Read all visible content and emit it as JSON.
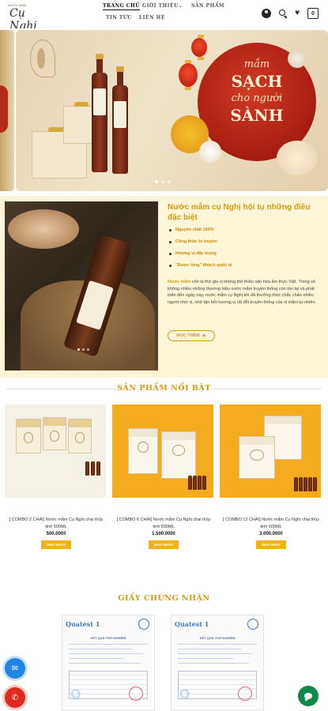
{
  "brand": {
    "tagline": "NƯỚC MẮM",
    "name": "Cụ Nghị"
  },
  "nav": {
    "items": [
      {
        "label": "TRANG CHỦ"
      },
      {
        "label": "GIỚI THIỆU"
      },
      {
        "label": "SẢN PHẨM"
      },
      {
        "label": "TIN TỨC"
      },
      {
        "label": "LIÊN HỆ"
      }
    ],
    "dropdown_caret": "⌄"
  },
  "header": {
    "cart_count": "0",
    "icons": [
      "user-icon",
      "search-icon",
      "heart-icon",
      "cart-icon"
    ]
  },
  "banner": {
    "line1": "mắm",
    "line2": "SẠCH",
    "line3": "cho người",
    "line4": "SÀNH",
    "slide_count": 3,
    "active_slide": 1
  },
  "intro": {
    "title": "Nước mắm cụ Nghị hội tụ những điều đặc biệt",
    "features": [
      "Nguyên chất 100%",
      "Công thức bí truyền",
      "Hương vị đặc trưng",
      "\"Được lòng\" khách quốc tế"
    ],
    "para_highlight": "Nước mắm",
    "para_rest": " vốn là thứ gia vị không thể thiếu văn hóa ẩm thực Việt. Trong số không nhiều những thương hiệu nước mắm truyền thống còn tồn tại và phát triển đến ngày nay, nước mắm cụ Nghị khi đã thưởng thức chắc chắn nhiều người nhớ vị, nhớ tận bởi hương vị rất đỗi truyền thống của vị mắm tự nhiên.",
    "read_more": "ĐỌC THÊM",
    "read_more_arrow": "▶"
  },
  "products_section": {
    "title": "SẢN PHẨM NỔI BẬT",
    "items": [
      {
        "name": "[ COMBO 2 CHAI] Nước mắm Cụ Nghị chai thủy tinh 500ML",
        "price": "500.000₫",
        "button": "MUA NGAY"
      },
      {
        "name": "[ COMBO 6 CHAI] Nước mắm Cụ Nghị chai thủy tinh 500ML",
        "price": "1.500.000₫",
        "button": "MUA NGAY"
      },
      {
        "name": "[ COMBO 12 CHAI] Nước mắm Cụ Nghị chai thủy tinh 500ML",
        "price": "3.000.000₫",
        "button": "MUA NGAY"
      }
    ]
  },
  "certificates_section": {
    "title": "GIẤY CHỨNG NHẬN",
    "logo": "Quatest 1",
    "heading": "KẾT QUẢ THỬ NGHIỆM"
  },
  "colors": {
    "accent": "#d59a10",
    "button": "#f2b21f",
    "messenger": "#1f86e8",
    "phone": "#e12a1f",
    "chat": "#0d8a4a"
  }
}
